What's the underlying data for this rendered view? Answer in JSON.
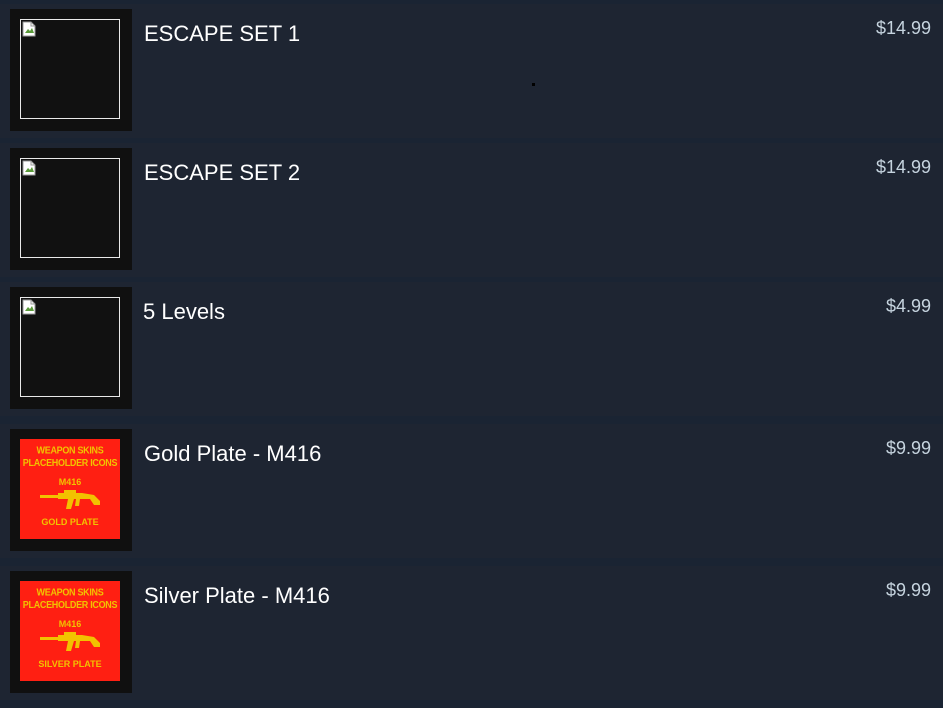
{
  "items": [
    {
      "title": "ESCAPE SET 1",
      "price": "$14.99",
      "thumb": "broken-image-icon"
    },
    {
      "title": "ESCAPE SET 2",
      "price": "$14.99",
      "thumb": "broken-image-icon"
    },
    {
      "title": "5 Levels",
      "price": "$4.99",
      "thumb": "broken-image-icon"
    },
    {
      "title": "Gold Plate - M416",
      "price": "$9.99",
      "thumb": "weapon-skin-placeholder",
      "poster": {
        "line1": "WEAPON SKINS",
        "line2": "PLACEHOLDER ICONS",
        "weapon": "M416",
        "skin": "GOLD PLATE"
      }
    },
    {
      "title": "Silver Plate - M416",
      "price": "$9.99",
      "thumb": "weapon-skin-placeholder",
      "poster": {
        "line1": "WEAPON SKINS",
        "line2": "PLACEHOLDER ICONS",
        "weapon": "M416",
        "skin": "SILVER PLATE"
      }
    }
  ],
  "colors": {
    "background": "#1a2433",
    "row": "#1e2532",
    "title": "#ffffff",
    "price": "#c6d4df",
    "poster_bg": "#ff1f12",
    "poster_text": "#f2c200"
  }
}
